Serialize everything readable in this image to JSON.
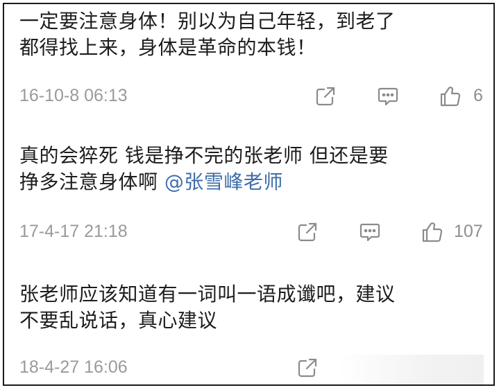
{
  "comments": [
    {
      "lines": [
        "一定要注意身体！别以为自己年轻，到老了",
        "都得找上来，身体是革命的本钱！"
      ],
      "time": "16-10-8 06:13",
      "likes": "6"
    },
    {
      "lines": [
        "真的会猝死  钱是挣不完的张老师 但还是要",
        "挣多注意身体啊 "
      ],
      "mention": "@张雪峰老师",
      "time": "17-4-17 21:18",
      "likes": "107"
    },
    {
      "lines": [
        "张老师应该知道有一词叫一语成谶吧，建议",
        "不要乱说话，真心建议"
      ],
      "time": "18-4-27 16:06"
    }
  ],
  "icons": {
    "share": "share-icon",
    "comment": "comment-icon",
    "like": "thumbs-up-icon"
  },
  "colors": {
    "text": "#1d1d1d",
    "meta": "#9a9a9a",
    "mention": "#3e6ea8"
  }
}
